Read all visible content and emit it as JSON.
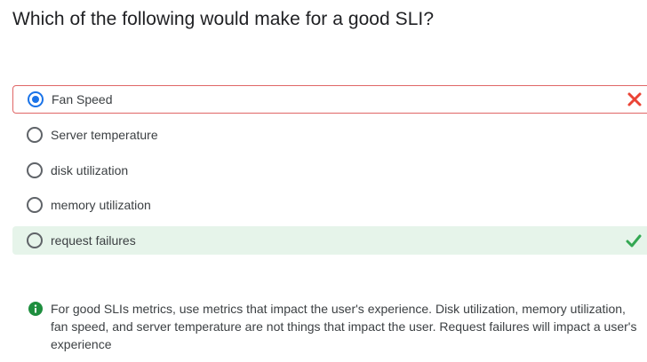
{
  "question": {
    "text": "Which of the following would make for a good SLI?"
  },
  "options": [
    {
      "label": "Fan Speed",
      "selected": true,
      "status": "incorrect"
    },
    {
      "label": "Server temperature",
      "selected": false,
      "status": "none"
    },
    {
      "label": "disk utilization",
      "selected": false,
      "status": "none"
    },
    {
      "label": "memory utilization",
      "selected": false,
      "status": "none"
    },
    {
      "label": "request failures",
      "selected": false,
      "status": "correct"
    }
  ],
  "feedback": {
    "icon": "info-icon",
    "text": "For good SLIs metrics, use metrics that impact the user's experience. Disk utilization, memory utilization, fan speed, and server temperature are not things that impact the user. Request failures will impact a user's experience"
  },
  "colors": {
    "selected_radio": "#1a73e8",
    "incorrect_border": "#e06666",
    "incorrect_icon": "#ea4335",
    "correct_background": "#e6f4ea",
    "correct_icon": "#34a853",
    "info_icon": "#1e8e3e"
  }
}
